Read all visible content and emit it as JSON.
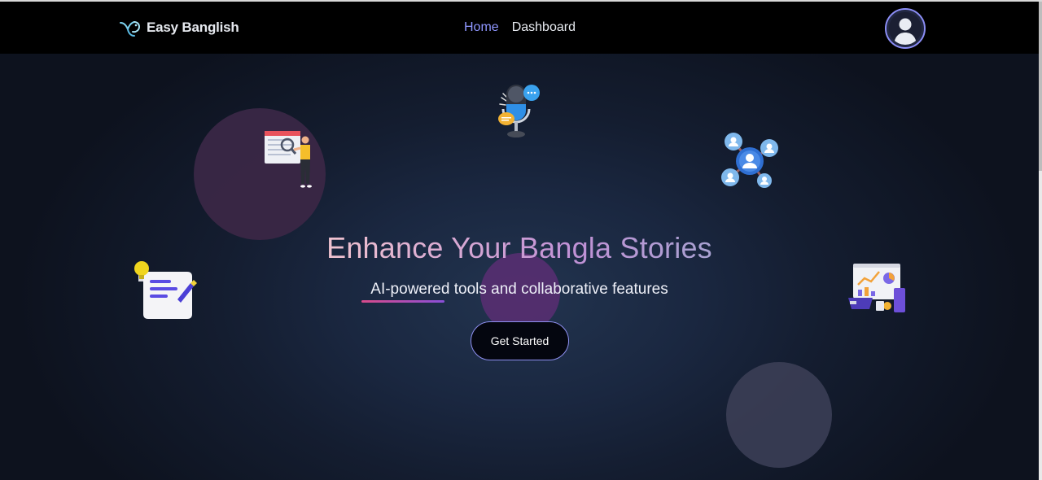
{
  "brand": {
    "name": "Easy Banglish",
    "logo_icon": "bird-logo-icon"
  },
  "nav": {
    "items": [
      {
        "label": "Home",
        "active": true
      },
      {
        "label": "Dashboard",
        "active": false
      }
    ]
  },
  "user": {
    "avatar_icon": "user-avatar-icon"
  },
  "hero": {
    "title": "Enhance Your Bangla Stories",
    "subtitle": "AI-powered tools and collaborative features",
    "cta_label": "Get Started"
  },
  "illustrations": [
    "microphone-chat-icon",
    "person-magnifier-presentation-icon",
    "network-users-icon",
    "document-lightbulb-pen-icon",
    "analytics-dashboard-icon"
  ],
  "colors": {
    "nav_active": "#8f96ff",
    "cta_border": "#8e8ff0",
    "underline_start": "#d84b8b",
    "underline_end": "#8a4fd8"
  }
}
